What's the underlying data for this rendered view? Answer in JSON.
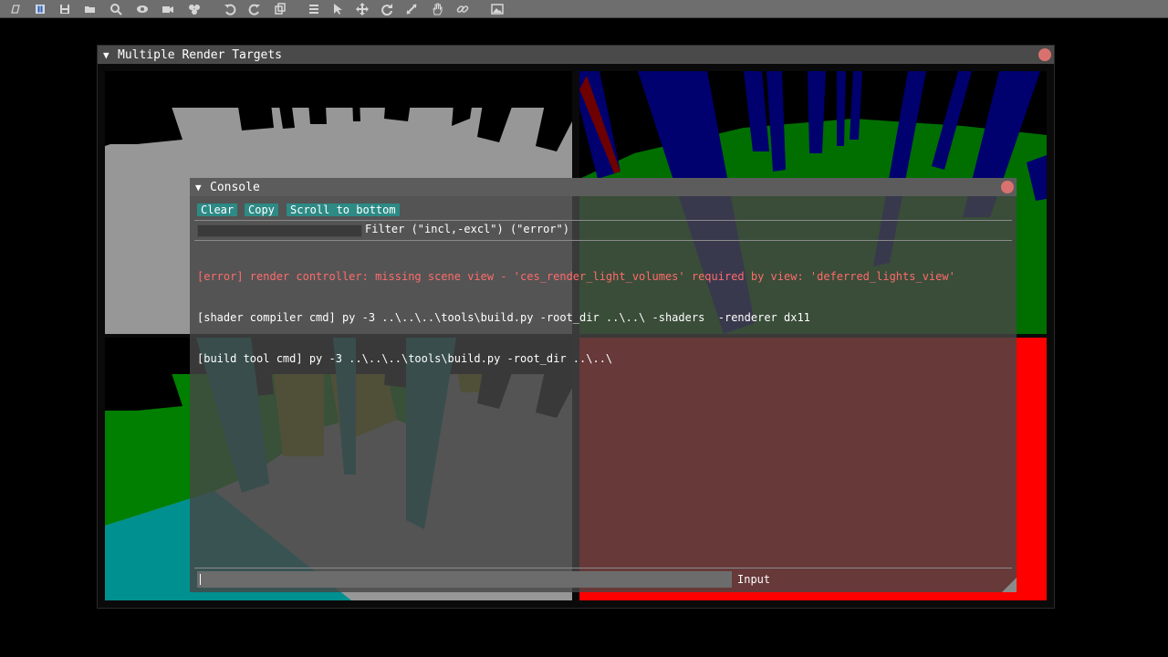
{
  "toolbar": {
    "icons": [
      "logo-icon",
      "pause-icon",
      "save-icon",
      "open-folder-icon",
      "search-icon",
      "eye-icon",
      "camera-icon",
      "components-icon",
      "undo-icon",
      "redo-icon",
      "copy-icon",
      "list-icon",
      "select-pointer-icon",
      "move-icon",
      "rotate-icon",
      "scale-icon",
      "hand-icon",
      "link-icon",
      "image-icon"
    ]
  },
  "mrt_window": {
    "title": "Multiple Render Targets",
    "collapse_glyph": "▼"
  },
  "console": {
    "title": "Console",
    "collapse_glyph": "▼",
    "buttons": {
      "clear": "Clear",
      "copy": "Copy",
      "scroll": "Scroll to bottom"
    },
    "filter": {
      "value": "",
      "label": "Filter (\"incl,-excl\") (\"error\")"
    },
    "log": [
      {
        "type": "error",
        "text": "[error] render controller: missing scene view - 'ces_render_light_volumes' required by view: 'deferred_lights_view'"
      },
      {
        "type": "info",
        "text": "[shader compiler cmd] py -3 ..\\..\\..\\tools\\build.py -root_dir ..\\..\\ -shaders  -renderer dx11"
      },
      {
        "type": "info",
        "text": "[build tool cmd] py -3 ..\\..\\..\\tools\\build.py -root_dir ..\\..\\"
      }
    ],
    "input": {
      "value": "",
      "label": "Input"
    }
  },
  "colors": {
    "accent_button": "#2d8a85",
    "error_text": "#ff6b6b",
    "close_button": "#d9726f"
  }
}
